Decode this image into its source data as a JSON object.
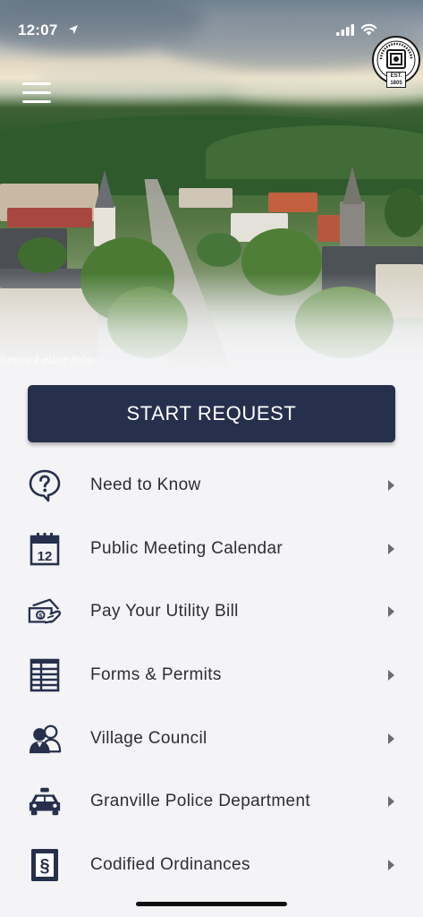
{
  "status_bar": {
    "time": "12:07",
    "icons": [
      "location-arrow-icon",
      "signal-icon",
      "wifi-icon"
    ]
  },
  "header": {
    "seal_name": "VILLAGE OF GRANVILLE, OHIO",
    "seal_est": "EST. 1805",
    "menu_icon": "hamburger-icon",
    "photo_credit": "henry Leiter foto"
  },
  "start_button": {
    "label": "START REQUEST"
  },
  "menu": {
    "items": [
      {
        "label": "Need to Know",
        "icon": "question-bubble-icon"
      },
      {
        "label": "Public Meeting Calendar",
        "icon": "calendar-icon"
      },
      {
        "label": "Pay Your Utility Bill",
        "icon": "money-hand-icon"
      },
      {
        "label": "Forms & Permits",
        "icon": "forms-icon"
      },
      {
        "label": "Village Council",
        "icon": "council-people-icon"
      },
      {
        "label": "Granville Police Department",
        "icon": "police-car-icon"
      },
      {
        "label": "Codified Ordinances",
        "icon": "ordinance-book-icon"
      }
    ]
  },
  "colors": {
    "primary": "#26304d",
    "icon": "#26304d",
    "text": "#2d2d33",
    "background": "#f4f4f6",
    "chevron": "#6b6b70"
  }
}
